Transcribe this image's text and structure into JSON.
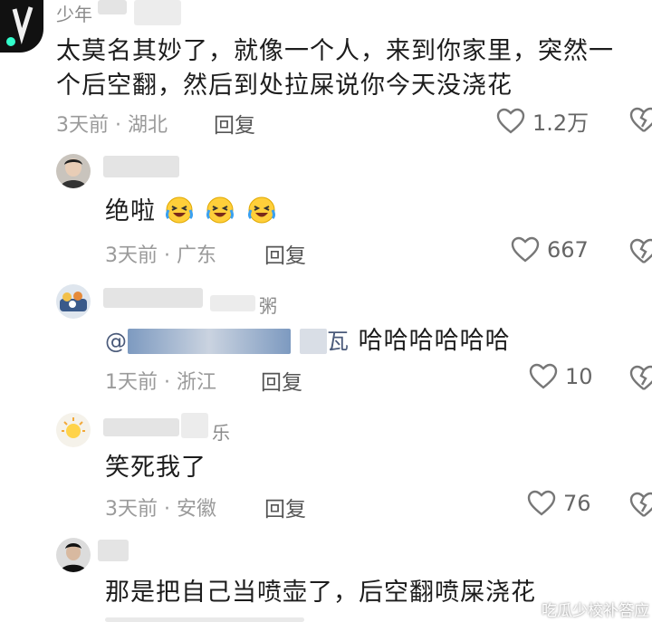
{
  "comments": [
    {
      "name": "少年",
      "text_lines": [
        "太莫名其妙了，就像一个人，来到你家里，突然一",
        "个后空翻，然后到处拉屎说你今天没浇花"
      ],
      "time": "3天前",
      "location": "湖北",
      "reply": "回复",
      "likes": "1.2万"
    },
    {
      "text": "绝啦",
      "emoji_icon": "laughing-crying-emoji",
      "time": "3天前",
      "location": "广东",
      "reply": "回复",
      "likes": "667"
    },
    {
      "name": "粥",
      "mention_prefix": "@",
      "mention_tail": "瓦",
      "text": "哈哈哈哈哈哈",
      "time": "1天前",
      "location": "浙江",
      "reply": "回复",
      "likes": "10"
    },
    {
      "name": "乐",
      "text": "笑死我了",
      "time": "3天前",
      "location": "安徽",
      "reply": "回复",
      "likes": "76"
    },
    {
      "text": "那是把自己当喷壶了，后空翻喷屎浇花"
    }
  ],
  "watermark": "吃瓜少校补答应",
  "icons": {
    "like": "heart-outline-icon",
    "dislike": "broken-heart-icon"
  },
  "colors": {
    "text": "#1c1c1c",
    "meta": "#9a9a9a",
    "mention": "#4a5a7a"
  }
}
